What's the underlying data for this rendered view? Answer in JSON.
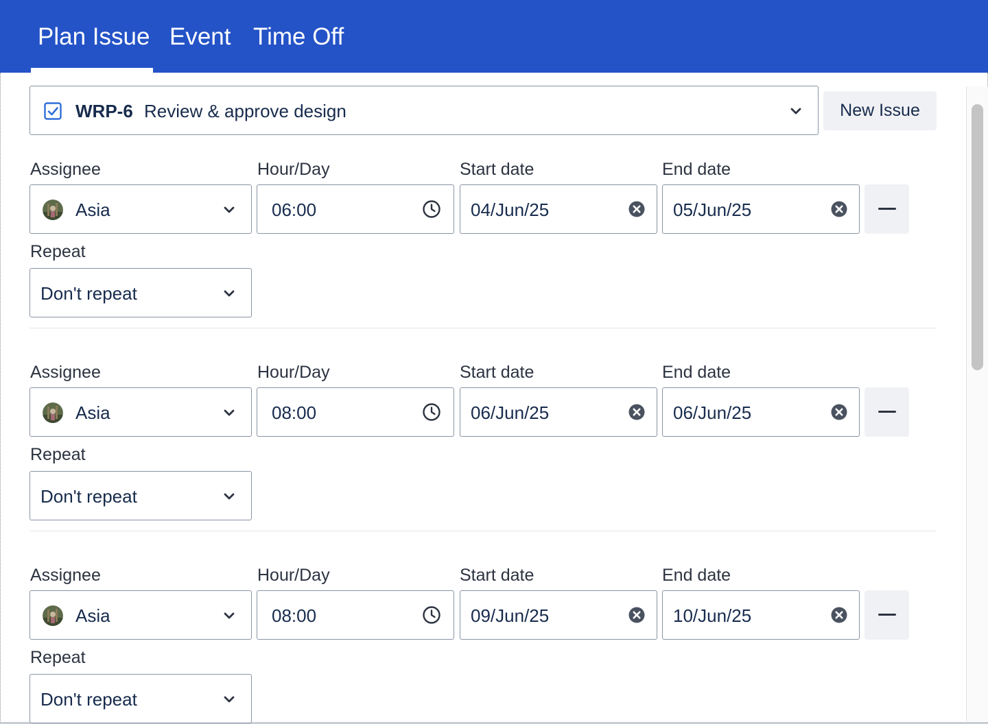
{
  "tabs": [
    {
      "label": "Plan Issue",
      "active": true
    },
    {
      "label": "Event",
      "active": false
    },
    {
      "label": "Time Off",
      "active": false
    }
  ],
  "issue": {
    "key": "WRP-6",
    "summary": "Review & approve design"
  },
  "new_issue_label": "New Issue",
  "labels": {
    "assignee": "Assignee",
    "hour_day": "Hour/Day",
    "start_date": "Start date",
    "end_date": "End date",
    "repeat": "Repeat"
  },
  "rows": [
    {
      "assignee": "Asia",
      "hours": "06:00",
      "start_date": "04/Jun/25",
      "end_date": "05/Jun/25",
      "repeat": "Don't repeat"
    },
    {
      "assignee": "Asia",
      "hours": "08:00",
      "start_date": "06/Jun/25",
      "end_date": "06/Jun/25",
      "repeat": "Don't repeat"
    },
    {
      "assignee": "Asia",
      "hours": "08:00",
      "start_date": "09/Jun/25",
      "end_date": "10/Jun/25",
      "repeat": "Don't repeat"
    }
  ],
  "colors": {
    "header_bg": "#2453c7",
    "text": "#172b4d",
    "check": "#2f6ed8"
  },
  "icons": {
    "issue_type": "checkbox-icon",
    "dropdown": "chevron-down-icon",
    "time": "clock-icon",
    "clear": "clear-icon",
    "remove": "minus-icon"
  }
}
